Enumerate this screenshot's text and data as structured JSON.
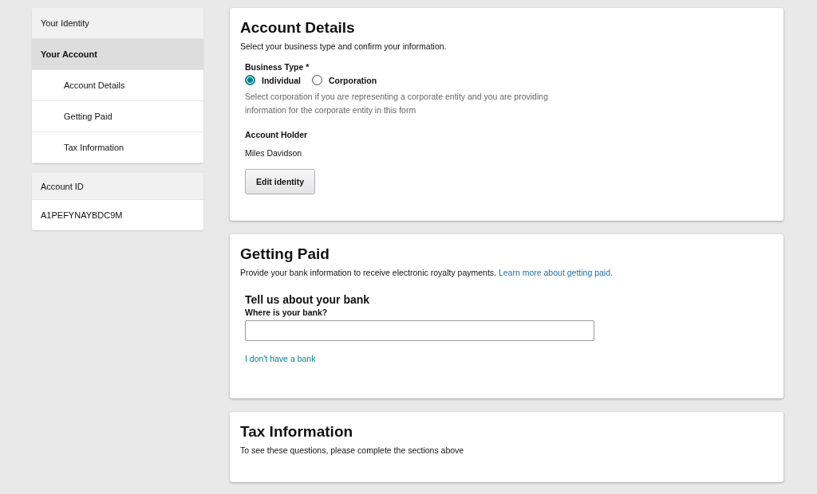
{
  "sidebar": {
    "items": [
      {
        "label": "Your Identity",
        "selected": false
      },
      {
        "label": "Your Account",
        "selected": true,
        "children": [
          {
            "label": "Account Details",
            "selected": false
          },
          {
            "label": "Getting Paid",
            "selected": false
          },
          {
            "label": "Tax Information",
            "selected": false
          }
        ]
      }
    ]
  },
  "account_id": {
    "title": "Account ID",
    "value": "A1PEFYNAYBDC9M"
  },
  "account_details": {
    "title": "Account Details",
    "subtitle": "Select your business type and confirm your information.",
    "business_type": {
      "label": "Business Type *",
      "options": [
        {
          "label": "Individual",
          "selected": true
        },
        {
          "label": "Corporation",
          "selected": false
        }
      ],
      "hint": "Select corporation if you are representing a corporate entity and you are providing information for the corporate entity in this form"
    },
    "holder_label": "Account Holder",
    "holder_name": "Miles Davidson",
    "button": "Edit identity"
  },
  "getting_paid": {
    "title": "Getting Paid",
    "subtitle": "Provide your bank information to receive electronic royalty payments.",
    "link": "Learn more about getting paid.",
    "bank_title": "Tell us about your bank",
    "bank_label": "Where is your bank?",
    "no_bank_link": "I don't have a bank"
  },
  "tax_information": {
    "title": "Tax Information",
    "subtitle": "To see these questions, please complete the sections above"
  }
}
